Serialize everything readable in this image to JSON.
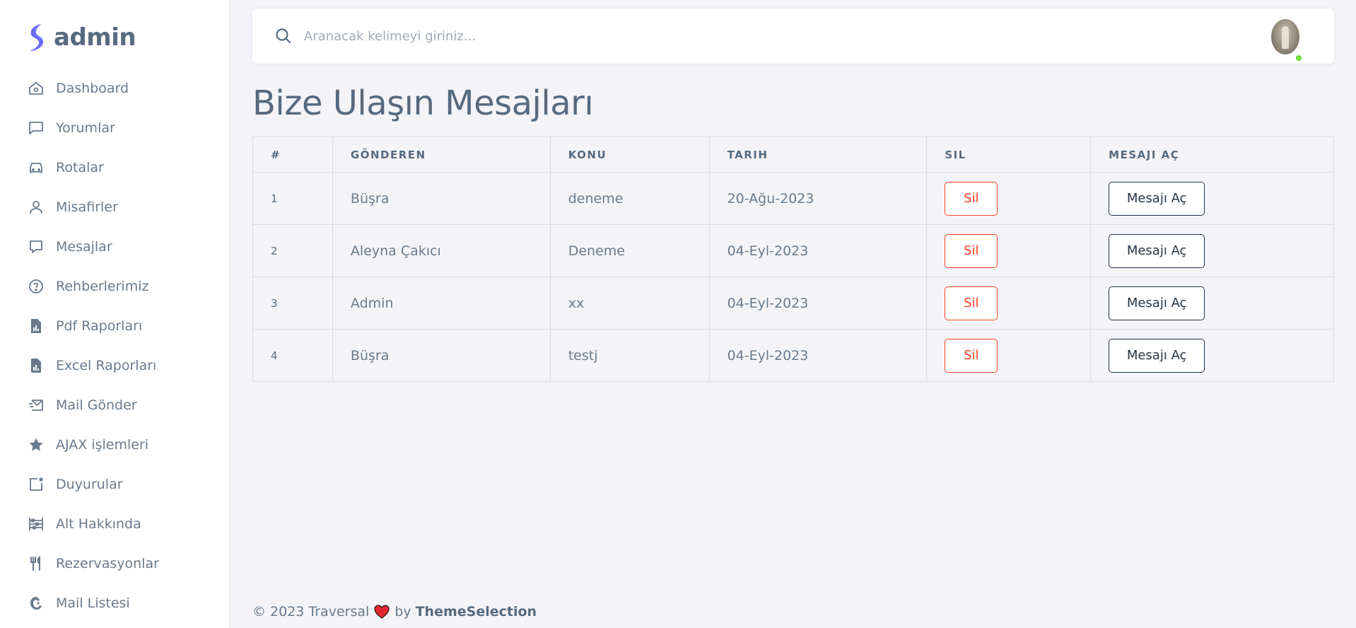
{
  "brand": {
    "name": "admin"
  },
  "sidebar": {
    "items": [
      {
        "label": "Dashboard",
        "icon": "home-icon"
      },
      {
        "label": "Yorumlar",
        "icon": "comment-icon"
      },
      {
        "label": "Rotalar",
        "icon": "car-icon"
      },
      {
        "label": "Misafirler",
        "icon": "user-icon"
      },
      {
        "label": "Mesajlar",
        "icon": "message-icon"
      },
      {
        "label": "Rehberlerimiz",
        "icon": "help-circle-icon"
      },
      {
        "label": "Pdf Raporları",
        "icon": "report-file-icon"
      },
      {
        "label": "Excel Raporları",
        "icon": "report-file-icon"
      },
      {
        "label": "Mail Gönder",
        "icon": "mail-send-icon"
      },
      {
        "label": "AJAX işlemleri",
        "icon": "star-icon"
      },
      {
        "label": "Duyurular",
        "icon": "notification-icon"
      },
      {
        "label": "Alt Hakkında",
        "icon": "abacus-icon"
      },
      {
        "label": "Rezervasyonlar",
        "icon": "restaurant-icon"
      },
      {
        "label": "Mail Listesi",
        "icon": "mailchimp-icon"
      }
    ]
  },
  "navbar": {
    "search_placeholder": "Aranacak kelimeyi giriniz...",
    "avatar_status_color": "#71dd37"
  },
  "page": {
    "title": "Bize Ulaşın Mesajları"
  },
  "table": {
    "headers": [
      "#",
      "GÖNDEREN",
      "KONU",
      "TARIH",
      "SIL",
      "MESAJI AÇ"
    ],
    "rows": [
      {
        "id": "1",
        "sender": "Büşra",
        "subject": "deneme",
        "date": "20-Ağu-2023",
        "delete_label": "Sil",
        "open_label": "Mesajı Aç"
      },
      {
        "id": "2",
        "sender": "Aleyna Çakıcı",
        "subject": "Deneme",
        "date": "04-Eyl-2023",
        "delete_label": "Sil",
        "open_label": "Mesajı Aç"
      },
      {
        "id": "3",
        "sender": "Admin",
        "subject": "xx",
        "date": "04-Eyl-2023",
        "delete_label": "Sil",
        "open_label": "Mesajı Aç"
      },
      {
        "id": "4",
        "sender": "Büşra",
        "subject": "testj",
        "date": "04-Eyl-2023",
        "delete_label": "Sil",
        "open_label": "Mesajı Aç"
      }
    ]
  },
  "footer": {
    "prefix": "© 2023 Traversal",
    "by": "by",
    "brand": "ThemeSelection"
  },
  "colors": {
    "accent": "#696cff",
    "danger": "#ff3e1d",
    "dark": "#233446",
    "text": "#697a8d"
  }
}
